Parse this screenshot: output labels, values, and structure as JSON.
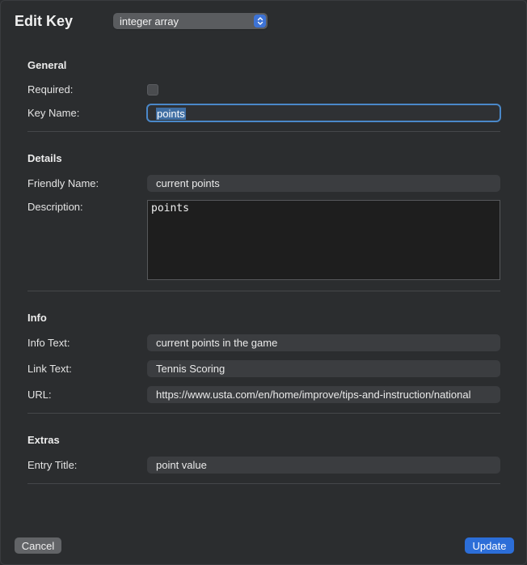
{
  "header": {
    "title": "Edit Key",
    "type_popup_value": "integer array"
  },
  "general": {
    "section_title": "General",
    "required_label": "Required:",
    "required_checked": false,
    "key_name_label": "Key Name:",
    "key_name_value": "points"
  },
  "details": {
    "section_title": "Details",
    "friendly_name_label": "Friendly Name:",
    "friendly_name_value": "current points",
    "description_label": "Description:",
    "description_value": "points"
  },
  "info": {
    "section_title": "Info",
    "info_text_label": "Info Text:",
    "info_text_value": "current points in the game",
    "link_text_label": "Link Text:",
    "link_text_value": "Tennis Scoring",
    "url_label": "URL:",
    "url_value": "https://www.usta.com/en/home/improve/tips-and-instruction/national"
  },
  "extras": {
    "section_title": "Extras",
    "entry_title_label": "Entry Title:",
    "entry_title_value": "point value"
  },
  "buttons": {
    "cancel_label": "Cancel",
    "update_label": "Update"
  },
  "colors": {
    "accent": "#2c6ed8",
    "focus_ring": "#4a88c9",
    "background": "#2b2d2f"
  },
  "icons": {
    "popup_indicator": "chevron-up-down-icon"
  }
}
